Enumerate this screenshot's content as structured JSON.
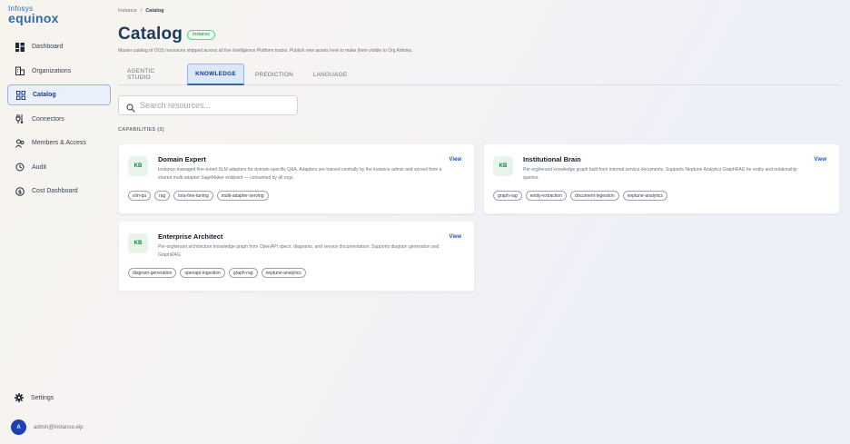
{
  "brand": {
    "line1": "Infosys",
    "line2": "equinox"
  },
  "sidebar": {
    "items": [
      {
        "label": "Dashboard",
        "icon": "dashboard-icon",
        "active": false
      },
      {
        "label": "Organizations",
        "icon": "building-icon",
        "active": false
      },
      {
        "label": "Catalog",
        "icon": "grid-icon",
        "active": true
      },
      {
        "label": "Connectors",
        "icon": "plug-icon",
        "active": false
      },
      {
        "label": "Members & Access",
        "icon": "members-icon",
        "active": false
      },
      {
        "label": "Audit",
        "icon": "history-icon",
        "active": false
      },
      {
        "label": "Cost Dashboard",
        "icon": "dollar-icon",
        "active": false
      }
    ],
    "settings_label": "Settings",
    "user": {
      "initial": "A",
      "email": "admin@instance.eip"
    }
  },
  "breadcrumb": {
    "parent": "Instance",
    "separator": "/",
    "current": "Catalog"
  },
  "header": {
    "title": "Catalog",
    "badge": "Instance",
    "subtitle": "Master catalog of OOS resources shipped across all five Intelligence Platform tracks. Publish new assets here to make them visible to Org Admins."
  },
  "tabs": [
    {
      "label": "AGENTIC STUDIO",
      "active": false
    },
    {
      "label": "KNOWLEDGE",
      "active": true
    },
    {
      "label": "PREDICTION",
      "active": false
    },
    {
      "label": "LANGUAGE",
      "active": false
    }
  ],
  "search": {
    "placeholder": "Search resources...",
    "value": ""
  },
  "section": {
    "label": "CAPABILITIES (3)"
  },
  "cards": [
    {
      "badge": "KB",
      "title": "Domain Expert",
      "description": "Instance-managed fine-tuned SLM adapters for domain-specific Q&A. Adapters are trained centrally by the instance admin and served from a shared multi-adapter SageMaker endpoint — consumed by all orgs.",
      "view_label": "View",
      "tags": [
        "slm-qa",
        "rag",
        "lora-fine-tuning",
        "multi-adapter-serving"
      ]
    },
    {
      "badge": "KB",
      "title": "Institutional Brain",
      "description": "Per-org/tenant knowledge graph built from internal service documents. Supports Neptune Analytics GraphRAG for entity and relationship queries.",
      "view_label": "View",
      "tags": [
        "graph-rag",
        "entity-extraction",
        "document-ingestion",
        "neptune-analytics"
      ]
    },
    {
      "badge": "KB",
      "title": "Enterprise Architect",
      "description": "Per-org/tenant architecture knowledge graph from OpenAPI specs, diagrams, and service documentation. Supports diagram generation and GraphRAG.",
      "view_label": "View",
      "tags": [
        "diagram-generation",
        "openapi-ingestion",
        "graph-rag",
        "neptune-analytics"
      ]
    }
  ],
  "colors": {
    "accent": "#2b6cb0",
    "title": "#1e3a5f",
    "kb_bg": "#e6f4ea",
    "kb_text": "#15803d",
    "link": "#1d4ed8"
  }
}
